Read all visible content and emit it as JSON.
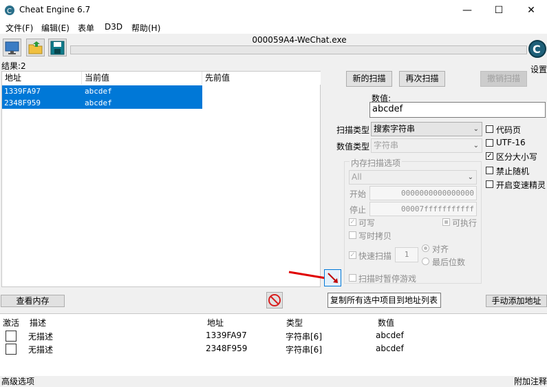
{
  "window": {
    "title": "Cheat Engine 6.7",
    "minimize": "—",
    "maximize": "☐",
    "close": "✕"
  },
  "menu": [
    "文件(F)",
    "编辑(E)",
    "表单",
    "D3D",
    "帮助(H)"
  ],
  "process": {
    "name": "000059A4-WeChat.exe"
  },
  "settings_label": "设置",
  "results": {
    "label": "结果:2",
    "columns": [
      "地址",
      "当前值",
      "先前值"
    ],
    "rows": [
      {
        "address": "1339FA97",
        "current": "abcdef",
        "previous": ""
      },
      {
        "address": "2348F959",
        "current": "abcdef",
        "previous": ""
      }
    ]
  },
  "scan": {
    "new_scan": "新的扫描",
    "next_scan": "再次扫描",
    "undo_scan": "撤销扫描",
    "value_label": "数值:",
    "value": "abcdef",
    "scan_type_label": "扫描类型",
    "scan_type": "搜索字符串",
    "value_type_label": "数值类型",
    "value_type": "字符串"
  },
  "options": {
    "codepage": "代码页",
    "utf16": "UTF-16",
    "case_sensitive": "区分大小写",
    "no_random": "禁止随机",
    "speedhack": "开启变速精灵"
  },
  "memory": {
    "title": "内存扫描选项",
    "region": "All",
    "start_label": "开始",
    "start": "0000000000000000",
    "stop_label": "停止",
    "stop": "00007fffffffffff",
    "writable": "可写",
    "executable": "可执行",
    "copy_on_write": "写时拷贝",
    "fast_scan": "快速扫描",
    "fast_value": "1",
    "align": "对齐",
    "last_digits": "最后位数",
    "pause": "扫描时暂停游戏"
  },
  "buttons": {
    "view_memory": "查看内存",
    "add_manual": "手动添加地址"
  },
  "tooltip": "复制所有选中项目到地址列表",
  "address_list": {
    "columns": [
      "激活",
      "描述",
      "地址",
      "类型",
      "数值"
    ],
    "rows": [
      {
        "description": "无描述",
        "address": "1339FA97",
        "type": "字符串[6]",
        "value": "abcdef"
      },
      {
        "description": "无描述",
        "address": "2348F959",
        "type": "字符串[6]",
        "value": "abcdef"
      }
    ]
  },
  "status": {
    "left": "高级选项",
    "right": "附加注释"
  },
  "colors": {
    "selection": "#0078d7",
    "arrow": "#e00000",
    "stop": "#d81e1e"
  }
}
